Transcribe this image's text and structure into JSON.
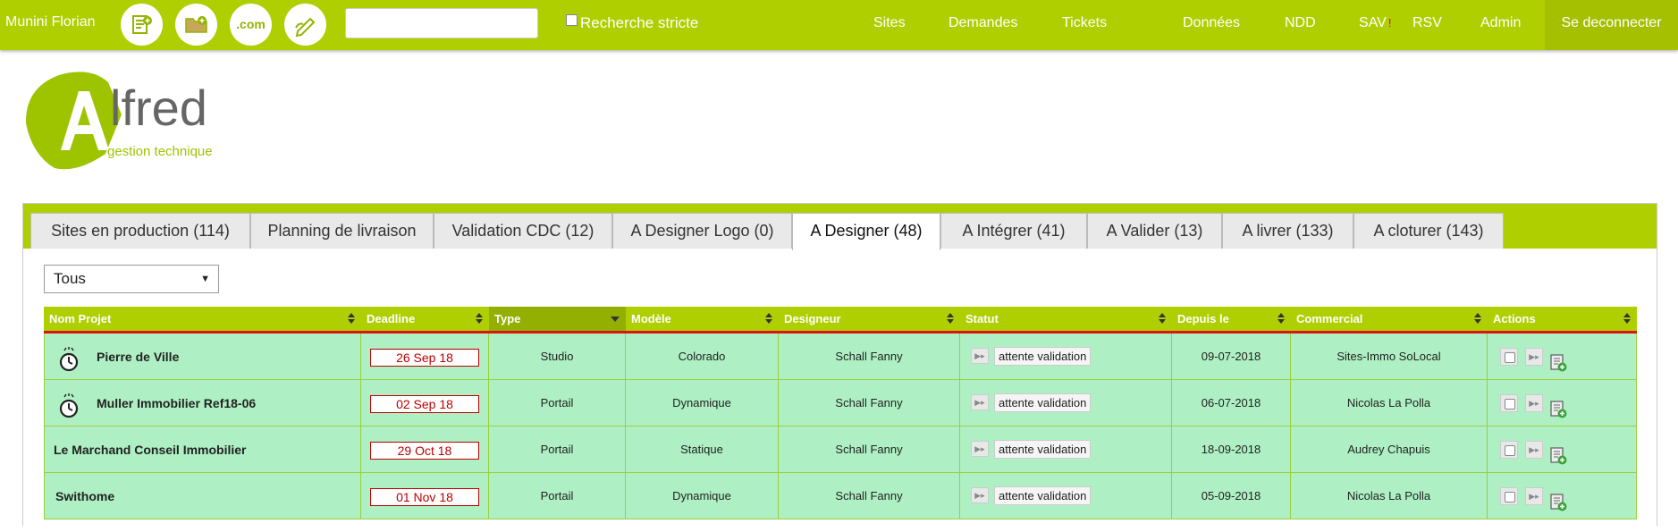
{
  "topbar": {
    "user": "Munini Florian",
    "icons": [
      "document-add-icon",
      "folder-add-icon",
      "domain-icon",
      "edit-icon"
    ],
    "domain_icon_text": ".com",
    "search_placeholder": "",
    "strict_label": "Recherche stricte",
    "nav": [
      "Sites",
      "Demandes",
      "Tickets",
      "Données",
      "NDD",
      "SAV",
      "RSV",
      "Admin"
    ],
    "sav_badge": "!",
    "logout": "Se deconnecter"
  },
  "logo": {
    "name": "lfred",
    "subtitle": "gestion technique"
  },
  "tabs": [
    "Sites en production (114)",
    "Planning de livraison",
    "Validation CDC (12)",
    "A Designer Logo (0)",
    "A Designer (48)",
    "A Intégrer (41)",
    "A Valider (13)",
    "A livrer (133)",
    "A cloturer (143)"
  ],
  "active_tab": "A Designer (48)",
  "filter": {
    "value": "Tous"
  },
  "table": {
    "columns": [
      "Nom Projet",
      "Deadline",
      "Type",
      "Modèle",
      "Designeur",
      "Statut",
      "Depuis le",
      "Commercial",
      "Actions"
    ],
    "sorted_column": "Type",
    "rows": [
      {
        "name": "Pierre de Ville",
        "urgent": true,
        "deadline": "26 Sep 18",
        "type": "Studio",
        "modele": "Colorado",
        "designeur": "Schall Fanny",
        "statut": "attente validation",
        "depuis": "09-07-2018",
        "commercial": "Sites-Immo SoLocal"
      },
      {
        "name": "Muller Immobilier Ref18-06",
        "urgent": true,
        "deadline": "02 Sep 18",
        "type": "Portail",
        "modele": "Dynamique",
        "designeur": "Schall Fanny",
        "statut": "attente validation",
        "depuis": "06-07-2018",
        "commercial": "Nicolas La Polla"
      },
      {
        "name": "Le Marchand Conseil Immobilier",
        "urgent": false,
        "deadline": "29 Oct 18",
        "type": "Portail",
        "modele": "Statique",
        "designeur": "Schall Fanny",
        "statut": "attente validation",
        "depuis": "18-09-2018",
        "commercial": "Audrey Chapuis"
      },
      {
        "name": "Swithome",
        "urgent": false,
        "deadline": "01 Nov 18",
        "type": "Portail",
        "modele": "Dynamique",
        "designeur": "Schall Fanny",
        "statut": "attente validation",
        "depuis": "05-09-2018",
        "commercial": "Nicolas La Polla"
      }
    ]
  },
  "colors": {
    "brand_green": "#b0cf00",
    "row_bg": "#aef0c4",
    "deadline_red": "#b00000",
    "header_rule": "#d9160d"
  }
}
